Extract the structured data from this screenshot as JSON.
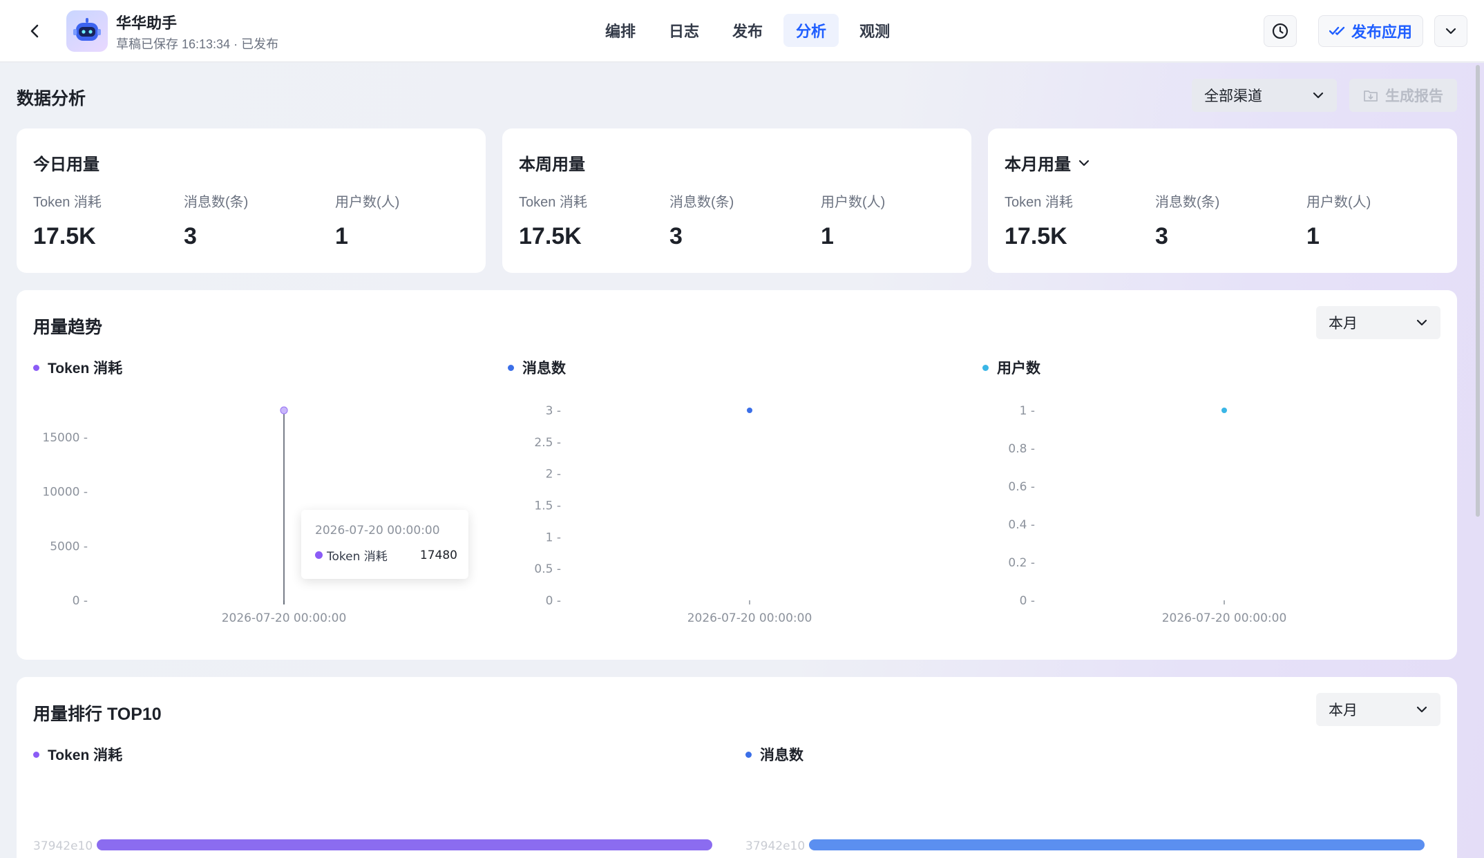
{
  "header": {
    "app_name": "华华助手",
    "app_status": "草稿已保存 16:13:34 · 已发布",
    "nav_tabs": [
      {
        "label": "编排",
        "active": false
      },
      {
        "label": "日志",
        "active": false
      },
      {
        "label": "发布",
        "active": false
      },
      {
        "label": "分析",
        "active": true
      },
      {
        "label": "观测",
        "active": false
      }
    ],
    "publish_label": "发布应用",
    "accent_color": "#1f5eff"
  },
  "page": {
    "title": "数据分析",
    "channel_select": "全部渠道",
    "report_button": "生成报告"
  },
  "stats": {
    "metric_labels": [
      "Token 消耗",
      "消息数(条)",
      "用户数(人)"
    ],
    "today": {
      "title": "今日用量",
      "values": [
        "17.5K",
        "3",
        "1"
      ]
    },
    "week": {
      "title": "本周用量",
      "values": [
        "17.5K",
        "3",
        "1"
      ]
    },
    "month": {
      "title": "本月用量",
      "values": [
        "17.5K",
        "3",
        "1"
      ]
    }
  },
  "trend": {
    "title": "用量趋势",
    "period": "本月",
    "tooltip": {
      "time": "2026-07-20 00:00:00",
      "series": "Token 消耗",
      "value": "17480"
    }
  },
  "ranking": {
    "title": "用量排行 TOP10",
    "period": "本月"
  },
  "chart_data": [
    {
      "type": "scatter",
      "series": [
        {
          "name": "Token 消耗",
          "color": "#8b5cf6",
          "values": [
            17480
          ]
        }
      ],
      "x": [
        "2026-07-20 00:00:00"
      ],
      "y_ticks": [
        "0",
        "5000",
        "10000",
        "15000"
      ],
      "ylim": [
        0,
        17480
      ],
      "grid": false
    },
    {
      "type": "scatter",
      "series": [
        {
          "name": "消息数",
          "color": "#3b6fe8",
          "values": [
            3
          ]
        }
      ],
      "x": [
        "2026-07-20 00:00:00"
      ],
      "y_ticks": [
        "0",
        "0.5",
        "1",
        "1.5",
        "2",
        "2.5",
        "3"
      ],
      "ylim": [
        0,
        3
      ],
      "grid": false
    },
    {
      "type": "scatter",
      "series": [
        {
          "name": "用户数",
          "color": "#3ab6e6",
          "values": [
            1
          ]
        }
      ],
      "x": [
        "2026-07-20 00:00:00"
      ],
      "y_ticks": [
        "0",
        "0.2",
        "0.4",
        "0.6",
        "0.8",
        "1"
      ],
      "ylim": [
        0,
        1
      ],
      "grid": false
    },
    {
      "type": "bar",
      "series": [
        {
          "name": "Token 消耗",
          "color": "#8b6cf0",
          "values": [
            17480
          ]
        }
      ],
      "categories": [
        "37942e10"
      ],
      "grid": false
    },
    {
      "type": "bar",
      "series": [
        {
          "name": "消息数",
          "color": "#5b8ff0",
          "values": [
            3
          ]
        }
      ],
      "categories": [
        "37942e10"
      ],
      "grid": false
    }
  ]
}
